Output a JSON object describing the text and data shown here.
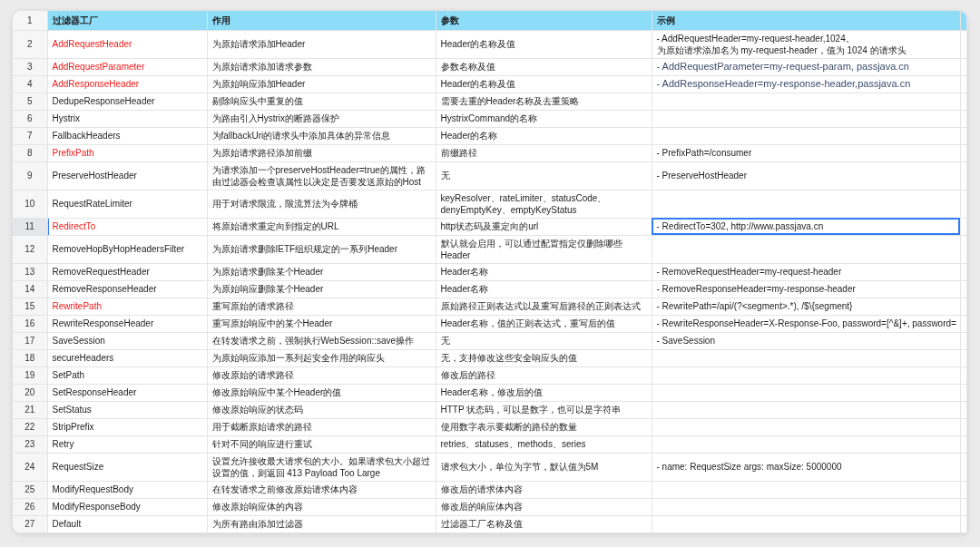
{
  "table": {
    "columns": [
      {
        "number": "1",
        "label": "过滤器工厂"
      },
      {
        "label": "作用"
      },
      {
        "label": "参数"
      },
      {
        "label": "示例"
      }
    ],
    "rows": [
      {
        "number": "2",
        "selected": false,
        "name": {
          "text": "AddRequestHeader",
          "flagged": true
        },
        "purpose": "为原始请求添加Header",
        "params": "Header的名称及值",
        "example": {
          "lines": [
            "- AddRequestHeader=my-request-header,1024。",
            "为原始请求添加名为 my-request-header，值为 1024 的请求头"
          ],
          "kind": "plain"
        }
      },
      {
        "number": "3",
        "selected": false,
        "name": {
          "text": "AddRequestParameter",
          "flagged": true
        },
        "purpose": "为原始请求添加请求参数",
        "params": "参数名称及值",
        "example": {
          "text": "- AddRequestParameter=my-request-param, passjava.cn",
          "kind": "styled"
        }
      },
      {
        "number": "4",
        "selected": false,
        "name": {
          "text": "AddResponseHeader",
          "flagged": true
        },
        "purpose": "为原始响应添加Header",
        "params": "Header的名称及值",
        "example": {
          "text": "- AddResponseHeader=my-response-header,passjava.cn",
          "kind": "styled"
        }
      },
      {
        "number": "5",
        "selected": false,
        "name": {
          "text": "DedupeResponseHeader",
          "flagged": false
        },
        "purpose": "剔除响应头中重复的值",
        "params": "需要去重的Header名称及去重策略"
      },
      {
        "number": "6",
        "selected": false,
        "name": {
          "text": "Hystrix",
          "flagged": false
        },
        "purpose": "为路由引入Hystrix的断路器保护",
        "params": "HystrixCommand的名称"
      },
      {
        "number": "7",
        "selected": false,
        "name": {
          "text": "FallbackHeaders",
          "flagged": false
        },
        "purpose": "为fallbackUri的请求头中添加具体的异常信息",
        "params": "Header的名称"
      },
      {
        "number": "8",
        "selected": false,
        "name": {
          "text": "PrefixPath",
          "flagged": true
        },
        "purpose": "为原始请求路径添加前缀",
        "params": "前缀路径",
        "example": {
          "text": "- PrefixPath=/consumer",
          "kind": "plain"
        }
      },
      {
        "number": "9",
        "selected": false,
        "name": {
          "text": "PreserveHostHeader",
          "flagged": false
        },
        "purpose": "为请求添加一个preserveHostHeader=true的属性，路由过滤器会检查该属性以决定是否要发送原始的Host",
        "params": "无",
        "example": {
          "text": "- PreserveHostHeader",
          "kind": "plain"
        }
      },
      {
        "number": "10",
        "selected": false,
        "name": {
          "text": "RequestRateLimiter",
          "flagged": false
        },
        "purpose": "用于对请求限流，限流算法为令牌桶",
        "params": "keyResolver、rateLimiter、statusCode、denyEmptyKey、emptyKeyStatus"
      },
      {
        "number": "11",
        "selected": true,
        "name": {
          "text": "RedirectTo",
          "flagged": true
        },
        "purpose": "将原始请求重定向到指定的URL",
        "params": "http状态码及重定向的url",
        "example": {
          "text": "- RedirectTo=302, http://www.passjava.cn",
          "kind": "plain"
        }
      },
      {
        "number": "12",
        "selected": false,
        "name": {
          "text": "RemoveHopByHopHeadersFilter",
          "flagged": false
        },
        "purpose": "为原始请求删除IETF组织规定的一系列Header",
        "params": "默认就会启用，可以通过配置指定仅删除哪些Header"
      },
      {
        "number": "13",
        "selected": false,
        "name": {
          "text": "RemoveRequestHeader",
          "flagged": false
        },
        "purpose": "为原始请求删除某个Header",
        "params": "Header名称",
        "example": {
          "text": "- RemoveRequestHeader=my-request-header",
          "kind": "plain"
        }
      },
      {
        "number": "14",
        "selected": false,
        "name": {
          "text": "RemoveResponseHeader",
          "flagged": false
        },
        "purpose": "为原始响应删除某个Header",
        "params": "Header名称",
        "example": {
          "text": "- RemoveResponseHeader=my-response-header",
          "kind": "plain"
        }
      },
      {
        "number": "15",
        "selected": false,
        "name": {
          "text": "RewritePath",
          "flagged": true
        },
        "purpose": "重写原始的请求路径",
        "params": "原始路径正则表达式以及重写后路径的正则表达式",
        "example": {
          "text": "- RewritePath=/api/(?<segment>.*), /$\\{segment}",
          "kind": "plain"
        }
      },
      {
        "number": "16",
        "selected": false,
        "name": {
          "text": "RewriteResponseHeader",
          "flagged": false
        },
        "purpose": "重写原始响应中的某个Header",
        "params": "Header名称，值的正则表达式，重写后的值",
        "example": {
          "text": "- RewriteResponseHeader=X-Response-Foo, password=[^&]+, password=",
          "kind": "plain"
        }
      },
      {
        "number": "17",
        "selected": false,
        "name": {
          "text": "SaveSession",
          "flagged": false
        },
        "purpose": "在转发请求之前，强制执行WebSession::save操作",
        "params": "无",
        "example": {
          "text": "- SaveSession",
          "kind": "plain"
        }
      },
      {
        "number": "18",
        "selected": false,
        "name": {
          "text": "secureHeaders",
          "flagged": false
        },
        "purpose": "为原始响应添加一系列起安全作用的响应头",
        "params": "无，支持修改这些安全响应头的值"
      },
      {
        "number": "19",
        "selected": false,
        "name": {
          "text": "SetPath",
          "flagged": false
        },
        "purpose": "修改原始的请求路径",
        "params": "修改后的路径"
      },
      {
        "number": "20",
        "selected": false,
        "name": {
          "text": "SetResponseHeader",
          "flagged": false
        },
        "purpose": "修改原始响应中某个Header的值",
        "params": "Header名称，修改后的值"
      },
      {
        "number": "21",
        "selected": false,
        "name": {
          "text": "SetStatus",
          "flagged": false
        },
        "purpose": "修改原始响应的状态码",
        "params": "HTTP 状态码，可以是数字，也可以是字符串"
      },
      {
        "number": "22",
        "selected": false,
        "name": {
          "text": "StripPrefix",
          "flagged": false
        },
        "purpose": "用于截断原始请求的路径",
        "params": "使用数字表示要截断的路径的数量"
      },
      {
        "number": "23",
        "selected": false,
        "name": {
          "text": "Retry",
          "flagged": false
        },
        "purpose": "针对不同的响应进行重试",
        "params": "retries、statuses、methods、series"
      },
      {
        "number": "24",
        "selected": false,
        "name": {
          "text": "RequestSize",
          "flagged": false
        },
        "purpose": "设置允许接收最大请求包的大小。如果请求包大小超过设置的值，则返回 413 Payload Too Large",
        "params": "请求包大小，单位为字节，默认值为5M",
        "example": {
          "text": "- name: RequestSize args: maxSize: 5000000",
          "kind": "plain"
        }
      },
      {
        "number": "25",
        "selected": false,
        "name": {
          "text": "ModifyRequestBody",
          "flagged": false
        },
        "purpose": "在转发请求之前修改原始请求体内容",
        "params": "修改后的请求体内容"
      },
      {
        "number": "26",
        "selected": false,
        "name": {
          "text": "ModifyResponseBody",
          "flagged": false
        },
        "purpose": "修改原始响应体的内容",
        "params": "修改后的响应体内容"
      },
      {
        "number": "27",
        "selected": false,
        "name": {
          "text": "Default",
          "flagged": false
        },
        "purpose": "为所有路由添加过滤器",
        "params": "过滤器工厂名称及值"
      }
    ]
  }
}
